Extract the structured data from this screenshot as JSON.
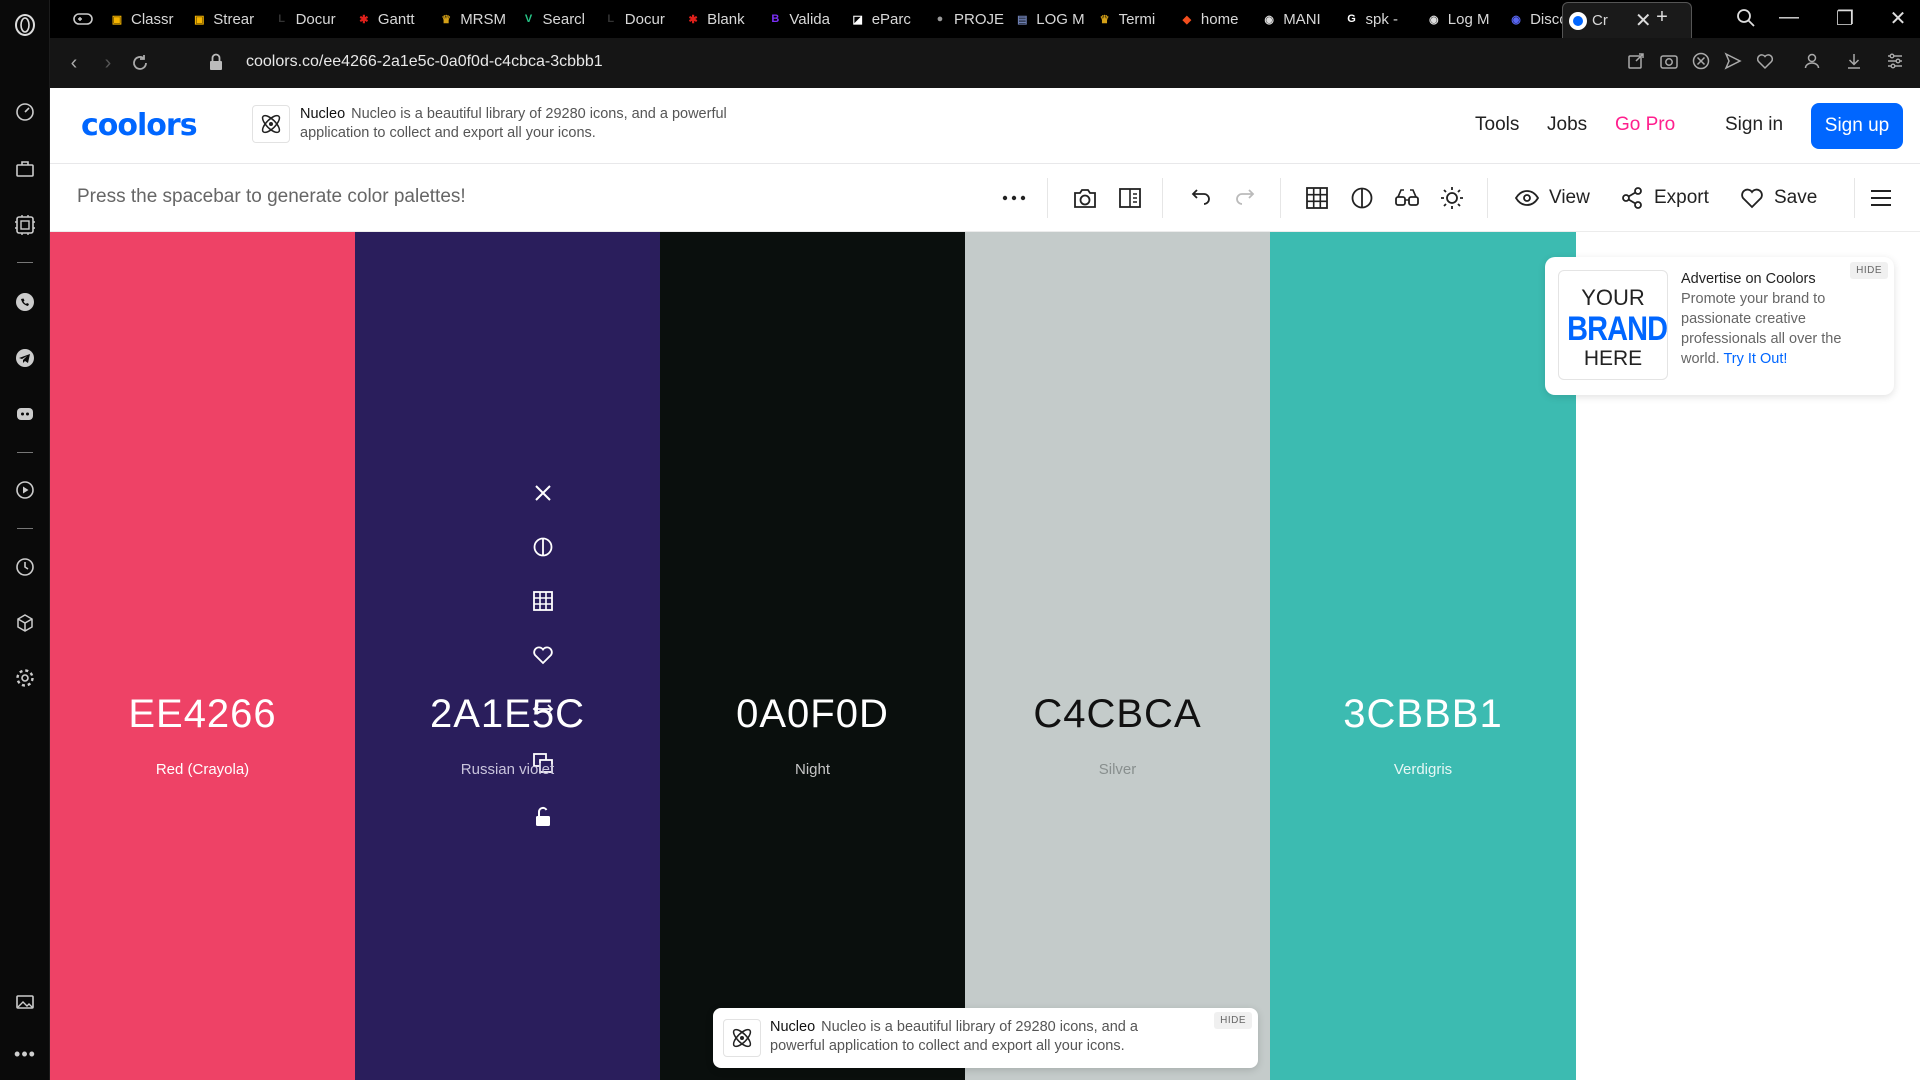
{
  "browser": {
    "tabs": [
      {
        "label": "Classr",
        "color": "#f5b400",
        "glyph": "▣"
      },
      {
        "label": "Strear",
        "color": "#f5b400",
        "glyph": "▣"
      },
      {
        "label": "Docur",
        "color": "#333",
        "glyph": "L"
      },
      {
        "label": "Gantt",
        "color": "#e0201b",
        "glyph": "✱"
      },
      {
        "label": "MRSM",
        "color": "#d4a017",
        "glyph": "♛"
      },
      {
        "label": "Searcl",
        "color": "#26c486",
        "glyph": "V"
      },
      {
        "label": "Docur",
        "color": "#333",
        "glyph": "L"
      },
      {
        "label": "Blank",
        "color": "#e0201b",
        "glyph": "✱"
      },
      {
        "label": "Valida",
        "color": "#7b2ff7",
        "glyph": "B"
      },
      {
        "label": "eParc",
        "color": "#ffffff",
        "glyph": "◪"
      },
      {
        "label": "PROJE",
        "color": "#999",
        "glyph": "●"
      },
      {
        "label": "LOG M",
        "color": "#6d7fb2",
        "glyph": "▤"
      },
      {
        "label": "Termi",
        "color": "#d4a017",
        "glyph": "♛"
      },
      {
        "label": "home",
        "color": "#f24e1e",
        "glyph": "◆"
      },
      {
        "label": "MANI",
        "color": "#ddd",
        "glyph": "◉"
      },
      {
        "label": "spk -",
        "color": "#ffffff",
        "glyph": "G"
      },
      {
        "label": "Log M",
        "color": "#ddd",
        "glyph": "◉"
      },
      {
        "label": "Disco",
        "color": "#5865f2",
        "glyph": "◉"
      }
    ],
    "active_tab": {
      "label": "Cr"
    },
    "url": "coolors.co/ee4266-2a1e5c-0a0f0d-c4cbca-3cbbb1"
  },
  "header": {
    "logo": "coolors",
    "ad": {
      "title": "Nucleo",
      "text": "Nucleo is a beautiful library of 29280 icons, and a powerful application to collect and export all your icons."
    },
    "nav": {
      "tools": "Tools",
      "jobs": "Jobs",
      "gopro": "Go Pro",
      "signin": "Sign in",
      "signup": "Sign up"
    }
  },
  "toolbar": {
    "hint": "Press the spacebar to generate color palettes!",
    "view": "View",
    "export": "Export",
    "save": "Save"
  },
  "palette": [
    {
      "hex": "EE4266",
      "name": "Red (Crayola)",
      "bg": "#EE4266",
      "fg": "#ffffff",
      "sub": "#ffffff"
    },
    {
      "hex": "2A1E5C",
      "name": "Russian violet",
      "bg": "#2A1E5C",
      "fg": "#ffffff",
      "sub": "#c9c4dc"
    },
    {
      "hex": "0A0F0D",
      "name": "Night",
      "bg": "#0A0F0D",
      "fg": "#ffffff",
      "sub": "#c6c6c6"
    },
    {
      "hex": "C4CBCA",
      "name": "Silver",
      "bg": "#C4CBCA",
      "fg": "#111111",
      "sub": "#888f8e"
    },
    {
      "hex": "3CBBB1",
      "name": "Verdigris",
      "bg": "#3CBBB1",
      "fg": "#ffffff",
      "sub": "#e6f7f5"
    }
  ],
  "ad_card": {
    "hide": "HIDE",
    "brand_l1": "YOUR",
    "brand_l2": "BRAND",
    "brand_l3": "HERE",
    "title": "Advertise on Coolors",
    "text": "Promote your brand to passionate creative professionals all over the world.",
    "cta": "Try It Out!"
  },
  "ad_bottom": {
    "hide": "HIDE",
    "title": "Nucleo",
    "text": "Nucleo is a beautiful library of 29280 icons, and a powerful application to collect and export all your icons."
  }
}
